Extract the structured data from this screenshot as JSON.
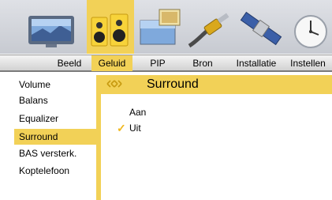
{
  "tabs": [
    {
      "label": "Beeld",
      "icon": "tv-icon",
      "active": false
    },
    {
      "label": "Geluid",
      "icon": "speakers-icon",
      "active": true
    },
    {
      "label": "PIP",
      "icon": "pip-icon",
      "active": false
    },
    {
      "label": "Bron",
      "icon": "source-cable-icon",
      "active": false
    },
    {
      "label": "Installatie",
      "icon": "satellite-icon",
      "active": false
    },
    {
      "label": "Instellen",
      "icon": "clock-icon",
      "active": false
    }
  ],
  "menu": {
    "items": [
      {
        "label": "Volume",
        "active": false
      },
      {
        "label": "Balans",
        "active": false
      },
      {
        "label": "Equalizer",
        "active": false
      },
      {
        "label": "Surround",
        "active": true
      },
      {
        "label": "BAS versterk.",
        "active": false
      },
      {
        "label": "Koptelefoon",
        "active": false
      }
    ]
  },
  "panel": {
    "title": "Surround",
    "icon": "surround-sound-icon",
    "options": [
      {
        "label": "Aan",
        "selected": false
      },
      {
        "label": "Uit",
        "selected": true
      }
    ],
    "check_glyph": "✓"
  },
  "colors": {
    "accent": "#f2d157",
    "check": "#f0b81f",
    "strip": "#c7cad1"
  }
}
